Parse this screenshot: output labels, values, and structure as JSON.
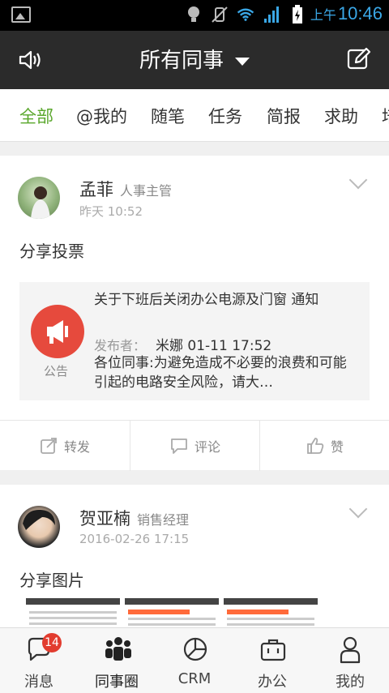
{
  "status_bar": {
    "am_label": "上午",
    "time": "10:46"
  },
  "app_bar": {
    "title": "所有同事"
  },
  "tabs": [
    "全部",
    "@我的",
    "随笔",
    "任务",
    "简报",
    "求助",
    "培"
  ],
  "feed": [
    {
      "name": "孟菲",
      "role": "人事主管",
      "time": "昨天 10:52",
      "share_text": "分享投票",
      "notice": {
        "label": "公告",
        "title": "关于下班后关闭办公电源及门窗 通知",
        "publisher_label": "发布者：",
        "publisher": "米娜 01-11 17:52",
        "body": "各位同事:为避免造成不必要的浪费和可能引起的电路安全风险，请大…"
      },
      "actions": {
        "forward": "转发",
        "comment": "评论",
        "like": "赞"
      }
    },
    {
      "name": "贺亚楠",
      "role": "销售经理",
      "time": "2016-02-26 17:15",
      "share_text": "分享图片"
    }
  ],
  "bottom_nav": [
    {
      "label": "消息",
      "badge": "14"
    },
    {
      "label": "同事圈"
    },
    {
      "label": "CRM"
    },
    {
      "label": "办公"
    },
    {
      "label": "我的"
    }
  ],
  "colors": {
    "accent_green": "#5aa72c",
    "notice_red": "#e64a3d",
    "clock_blue": "#3aa7e6"
  }
}
